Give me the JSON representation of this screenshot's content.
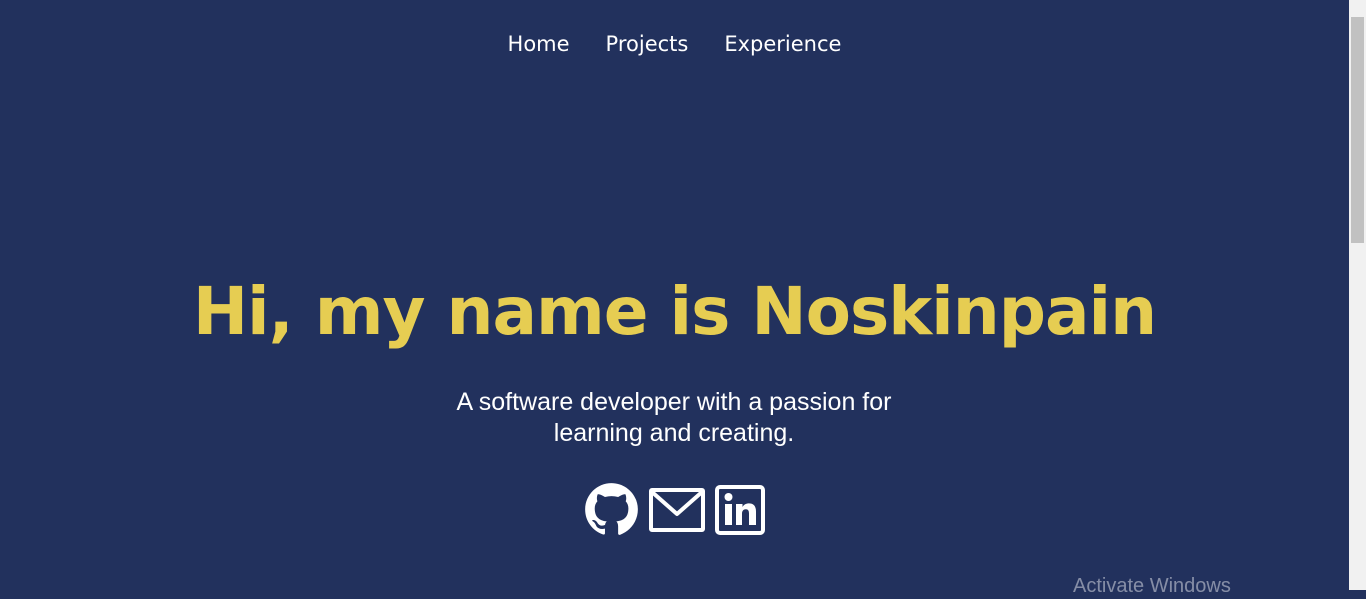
{
  "nav": {
    "items": [
      {
        "label": "Home"
      },
      {
        "label": "Projects"
      },
      {
        "label": "Experience"
      }
    ]
  },
  "hero": {
    "title": "Hi, my name is Noskinpain",
    "tagline": "A software developer with a passion for learning and creating."
  },
  "socials": {
    "icons": [
      "github-icon",
      "mail-icon",
      "linkedin-icon"
    ]
  },
  "overlay": {
    "watermark": "Activate Windows"
  },
  "colors": {
    "background": "#22315d",
    "accent": "#e6cd52",
    "text": "#ffffff"
  }
}
